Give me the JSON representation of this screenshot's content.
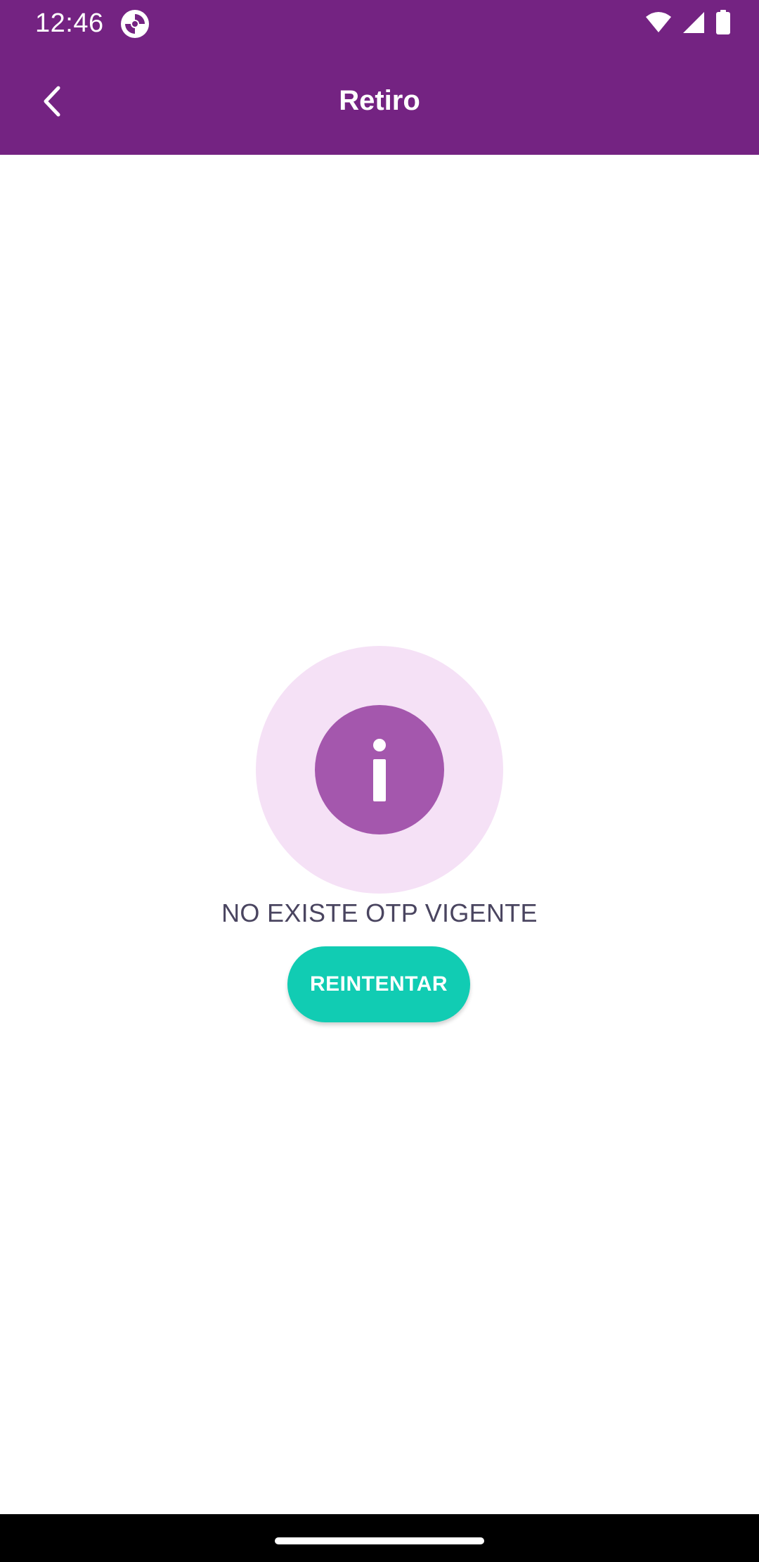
{
  "status_bar": {
    "time": "12:46",
    "icons": [
      "app-notification-icon",
      "wifi-icon",
      "cell-signal-icon",
      "battery-icon"
    ]
  },
  "app_bar": {
    "title": "Retiro",
    "back_icon": "chevron-left-icon"
  },
  "main": {
    "info_icon": "info-icon",
    "message": "NO EXISTE OTP VIGENTE",
    "retry_label": "REINTENTAR"
  },
  "colors": {
    "primary": "#742382",
    "info_circle_outer": "#f5e1f6",
    "info_circle_inner": "#a457ad",
    "accent_button": "#11ccb3",
    "message_text": "#4a4560"
  }
}
